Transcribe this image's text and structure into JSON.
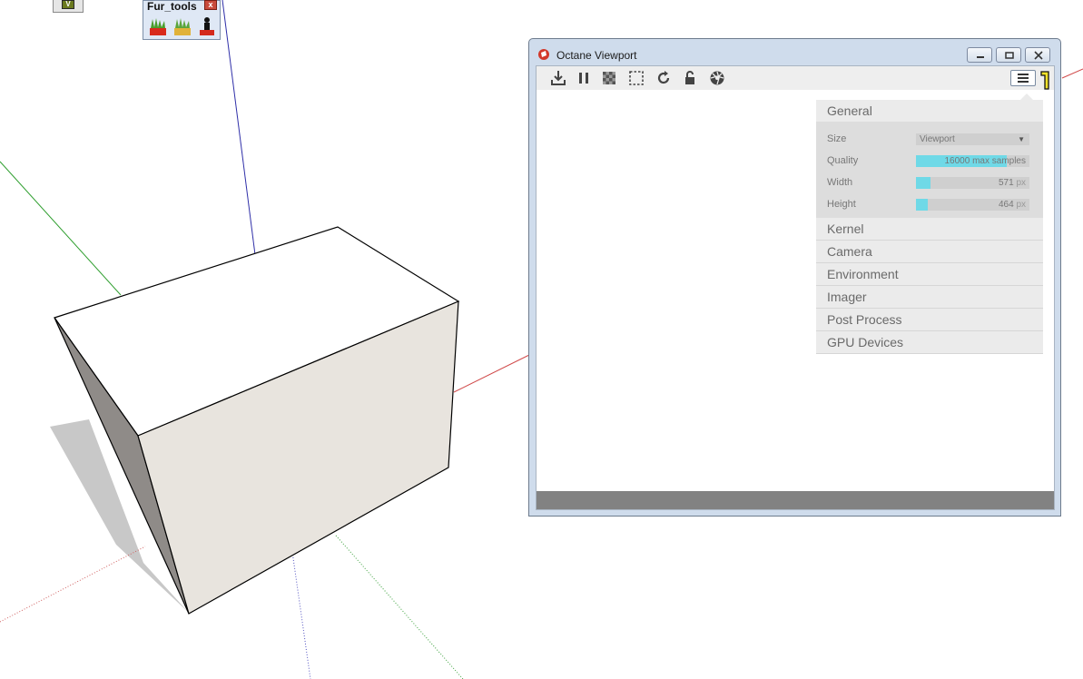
{
  "sketchup": {
    "mini_toolbar_glyph": "V",
    "fur_tools": {
      "title": "Fur_tools",
      "close_glyph": "x",
      "buttons": [
        {
          "icon": "fur-red-icon"
        },
        {
          "icon": "fur-yellow-icon"
        },
        {
          "icon": "fur-figure-icon"
        }
      ]
    }
  },
  "octane_window": {
    "title": "Octane Viewport",
    "title_controls": [
      "minimize",
      "restore",
      "close"
    ],
    "toolbar": [
      {
        "icon": "download-icon"
      },
      {
        "icon": "pause-icon"
      },
      {
        "icon": "checker-icon"
      },
      {
        "icon": "region-select-icon"
      },
      {
        "icon": "refresh-icon"
      },
      {
        "icon": "unlock-icon"
      },
      {
        "icon": "aperture-icon"
      },
      {
        "icon": "menu-icon"
      }
    ],
    "settings": {
      "general_label": "General",
      "size": {
        "label": "Size",
        "value": "Viewport"
      },
      "quality": {
        "label": "Quality",
        "value": "16000 max samples",
        "fill_fraction": 0.8
      },
      "width": {
        "label": "Width",
        "value": "571",
        "unit": "px",
        "fill_fraction": 0.13
      },
      "height": {
        "label": "Height",
        "value": "464",
        "unit": "px",
        "fill_fraction": 0.1
      },
      "sections": [
        "Kernel",
        "Camera",
        "Environment",
        "Imager",
        "Post Process",
        "GPU Devices"
      ]
    }
  },
  "colors": {
    "accent_fill": "#6fd9e7",
    "status_bar": "#828282",
    "window_frame": "#cfdcec"
  }
}
